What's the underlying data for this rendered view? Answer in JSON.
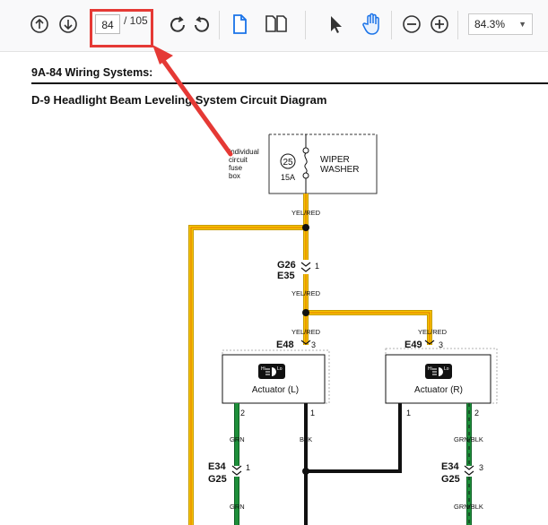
{
  "toolbar": {
    "page_current": "84",
    "page_total": "/ 105",
    "zoom": "84.3%",
    "icons": [
      "prev-page-icon",
      "next-page-icon",
      "rotate-clockwise-icon",
      "rotate-counterclockwise-icon",
      "single-page-icon",
      "two-page-icon",
      "select-cursor-icon",
      "hand-tool-icon",
      "zoom-out-icon",
      "zoom-in-icon"
    ],
    "highlight_color": "#e53935"
  },
  "document": {
    "section": "9A-84  Wiring Systems:",
    "title": "D-9 Headlight Beam Leveling System Circuit Diagram",
    "fuse_box_label": [
      "Individual",
      "circuit",
      "fuse",
      "box"
    ],
    "fuse_number": "25",
    "fuse_rating": "15A",
    "fuse_name": [
      "WIPER",
      "WASHER"
    ],
    "wires": {
      "yel_red_1": "YEL/RED",
      "yel_red_2": "YEL/RED",
      "yel_red_3": "YEL/RED",
      "yel_red_4": "YEL/RED",
      "grn_1": "GRN",
      "grn_2": "GRN",
      "blk": "BLK",
      "grn_blk_1": "GRN/BLK",
      "grn_blk_2": "GRN/BLK"
    },
    "connectors": {
      "g26": "G26",
      "e35": "E35",
      "g26_pin": "1",
      "e48": "E48",
      "e48_pin": "3",
      "e49": "E49",
      "e49_pin": "3",
      "e34_left": "E34",
      "g25_left": "G25",
      "e34_left_pin": "1",
      "e34_right": "E34",
      "g25_right": "G25",
      "e34_right_pin": "3"
    },
    "actuator_left": {
      "label": "Actuator (L)",
      "pin_left": "2",
      "pin_right": "1"
    },
    "actuator_right": {
      "label": "Actuator (R)",
      "pin_left": "1",
      "pin_right": "2"
    },
    "wire_colors": {
      "yellow": "#f5c400",
      "green": "#1e8f3a",
      "black": "#111111"
    }
  }
}
